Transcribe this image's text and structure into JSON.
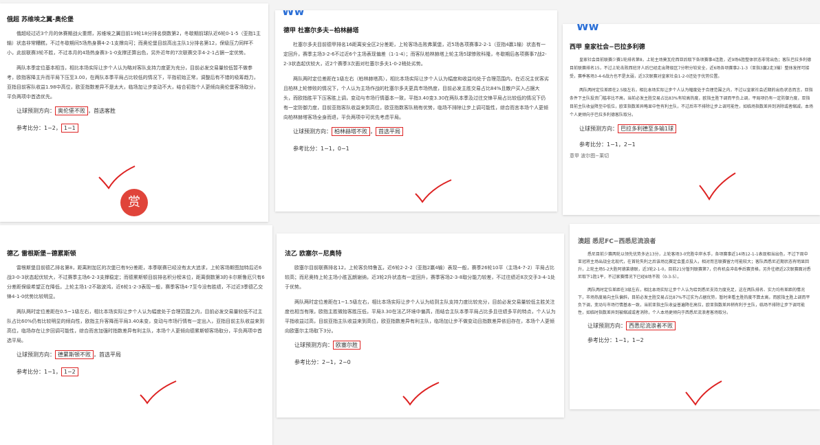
{
  "logos": {
    "c2": "Ww",
    "c3": "Ww"
  },
  "reward": "赏",
  "cards": [
    {
      "title": "俄超 苏维埃之翼-奥伦堡",
      "paras": [
        "俄超经过近3个月的休赛期战火重燃，苏维埃之翼目前19轮18分排名倒数第2，冬歇期前球队近6轮0-1-5（亚指1主输）状态非常糟糕，不过冬歇期间5场热身赛4-2-1支撑向可；而奥伦堡目前高出主队1分排名第12，保级压力同样不小，此前联赛3轮不胜，不过本月的4场热身赛3-1-0支撑还算出色，另外近年的7次联赛交手4-2-1占据一定优势。",
        "两队本季定位基本相当，相比本场实际让步个人认为略对客队支持力度更为充分，目前必发交易量较低暂不做参考，欧指客降主升而平局下压至3.00，在两队本季平局占比较低的情况下，平指初始正常，调整后有不错的吸筹趋力，亚指目前客队收益1.98中高位，欧亚指数差异不是太大，临场加让步变动不大，结合初指个人更倾向奥伦堡客场取分，平负两项中首选优先。"
      ],
      "predict_label": "让球预测方向：",
      "predict": "奥伦堡不败",
      "predict_extra": "首选客胜",
      "ref_label": "参考比分：1−2",
      "ref_boxed": "1−1",
      "ref_extra": ""
    },
    {
      "title": "德甲 杜塞尔多夫−柏林赫塔",
      "paras": [
        "杜塞尔多夫目前德甲排名16距离安全区2分差距，上轮客场击败弗莱堡，近5场各项赛事2-2-1（亚指4赢1输）状态有一定回升，赛季主场3-2-6不过近6个主场表现偏差（1-1-4）；而客队柏林赫塔上轮主场5球惨败科隆，冬歇期后各项赛事7战2-2-3状态起伏较大，近2个赛季3次面对杜塞尔多夫1-0-2稍处劣势。",
        "两队两时定位差距在1级左右（柏林赫塔高），相比本场实际让步个人认为幅度和收益均处于合理范围内，在近况主优客劣且柏林上轮惨败的情况下，个人认为主场作战的杜塞尔多夫更具市场热度，目前必发主胜交易占比84%且散户买入占据大头，而欧指胜平下压客胜上调，变动与市场行情基本一致，平指3.40变3.30在两队本季及过往交锋平局占比较低的情况下仍有一定防御力度，目前亚指客队收益来到高位，欧亚指数客队稍有优势，临场不排除让步上调可能性，综合而言本场个人更倾向柏林赫塔客场全身而退，平负两项中可优先考虑平局。"
      ],
      "predict_label": "让球预测方向：",
      "predict": "柏林赫塔不败",
      "predict_extra": "首选平局",
      "ref_label": "参考比分：1−1，0−1",
      "ref_boxed": "",
      "ref_extra": ""
    },
    {
      "title": "西甲 皇家社会−巴拉多利德",
      "paras": [
        "皇家社会目前联赛少赛1轮排名第8，上轮主场莫瓦伦西亚后取下各项赛事4连胜，近9场6胜整体状态非常出色；客队巴拉多利德目前联赛排名15，不过上轮击败西班牙人后已经走出降级区7分积分较安全，近6场各项赛事2-1-3（亚指3赢2走3输）整体发挥可接受，赛季客场3-4-6战力也不是太弱，近3次联赛对皇家社会1-2-0还处于优势位置。",
        "两队两时定位差距在2.5级左右，相比本场实际让步个人认为幅度处于合理范围之内，不过以皇家社会近期的出色状态而言，亚指条件下主队投资门槛非比不高，当前必发主胜交易占比83%有较高热度，欧指主胜下调而平负上调，平局项仍有一定防御力度，亚指目前主队收益降至中低位，欧亚指数差异略显中性有利主队，不过后市不排除让步上调可能性，如临场指数差异到消除或者缩减，本场个人更倾向于巴拉多利德客队取分。"
      ],
      "predict_label": "让球预测方向：",
      "predict": "巴拉多利德至多输1球",
      "predict_extra": "",
      "ref_label": "参考比分：1−1，2−1",
      "ref_boxed": "",
      "ref_extra": "意甲 波尔图−莱切"
    },
    {
      "title": "德乙 雷根斯堡−德累斯顿",
      "paras": [
        "雷根斯堡目前德乙排名第8，距离附加区的次堡已有9分差距，本季联赛已经没有太大追求，上轮客场斯图加特后近6战3-0-3状态起伏较大，不过赛季主场6-2-3支撑稳定；而德累斯顿目前排名积分榜末位，距离倒数第3的卡尔斯鲁厄只有6分差距保级希望正在降低，上轮主场1-2不敌波鸿，近6轮1-2-3表现一般，赛季客场4-7至今没有胜绩，不过近3季德乙交锋4-1-0优势比较明显。",
        "两队两时定位差距在0.5~1级左右，相比本场实际让步个人认为幅度处于合理范围之内，目前必发交易量较低不过主队占比60%仍有比较明显的倾向性，欧指主升客降而平局3.40未变，变动与市场行情有一定出入，亚指目前主队收益来到高位，临场存在让步回调可能性，综合而言加强时指数差异有利主队，本场个人更倾向德累斯顿客场取分，平负两项中首选平局。"
      ],
      "predict_label": "让球预测方向：",
      "predict": "德累斯顿不败",
      "predict_extra": "首选平局",
      "ref_label": "参考比分：1−1",
      "ref_boxed": "1−2",
      "ref_extra": ""
    },
    {
      "title": "法乙 欧塞尔−尼奥特",
      "paras": [
        "欧塞尔目前联赛排名12，上轮客负特鲁瓦，近6轮2-2-2（亚指2赢4输）表现一般，赛季26轮10平（主场4-7-2）平局占比较高；而尼奥特上轮主场小胜瓦朗谢纳，近3轮2升状态有一定回升，赛季客场2-3-8取分能力较差，不过往绩近8次交手3-4-1处于优势。",
        "两队两时定位差距在1~1.5级左右，相比本场实际让步个人认为给到主队支持力度比较充分，目前必发交易量较低主胜关注度也相当有限，欧指主胜微抬客胜压低，平局3.30在法乙环境中偏高，而结合主队本季平局占比多且往绩多平的特点，个人认为平指收益过高，目前亚指主队收益来到高位，欧亚指数差异有利主队，临场加让步不做变动且指数差异依旧存在，本场个人更倾向欧塞尔主场取下3分。"
      ],
      "predict_label": "让球预测方向：",
      "predict": "欧塞尔胜",
      "predict_extra": "",
      "ref_label": "参考比分：2−1，2−0",
      "ref_boxed": "",
      "ref_extra": ""
    },
    {
      "title": "澳超 悉尼FC−西悉尼流浪者",
      "paras": [
        "悉尼目前少赛两轮以领先优势多达13分，上轮客场3-0完胜中岸水手，各项赛事近14场12-1-1表现相当出色，不过下周中亚冠将主场出战全北现代，在首轮失利之后该场比赛定会重点投入，相对而言联赛留力可能较大；客队西悉尼近期状态有明显回升，上轮主场5-2大胜阿德莱德联，近3轮2-1-0，目前21分暂列联赛第7，仍有机会冲击季后赛资格，另外往绩近2次联赛面对悉尼取下1胜1平，不过家赛情况下已经8场不败（0-3-5）。",
        "两队两时定位差距在3级左右，相比本场实际让步个人认为给到悉尼支持力度充足，这在两队排名、实力均有差距的情况下，市场热度易向主队偏斜，目前必发主胜交易占比87%不过实为占据优势，暂时来看主胜热度不算太高，而欧指主胜上调而平负下调，变动与市场行情基本一致，当前亚指主队收益普遍降在高位，欧亚指数差异稍有利于主队，临场不排除让步下调可能性，如临时指数差异到被缩减或者消除，个人本场更倾向于西悉尼流浪者客场取分。"
      ],
      "predict_label": "让球预测方向：",
      "predict": "西悉尼流浪者不败",
      "predict_extra": "",
      "ref_label": "参考比分：1−1，1−2",
      "ref_boxed": "",
      "ref_extra": ""
    }
  ]
}
